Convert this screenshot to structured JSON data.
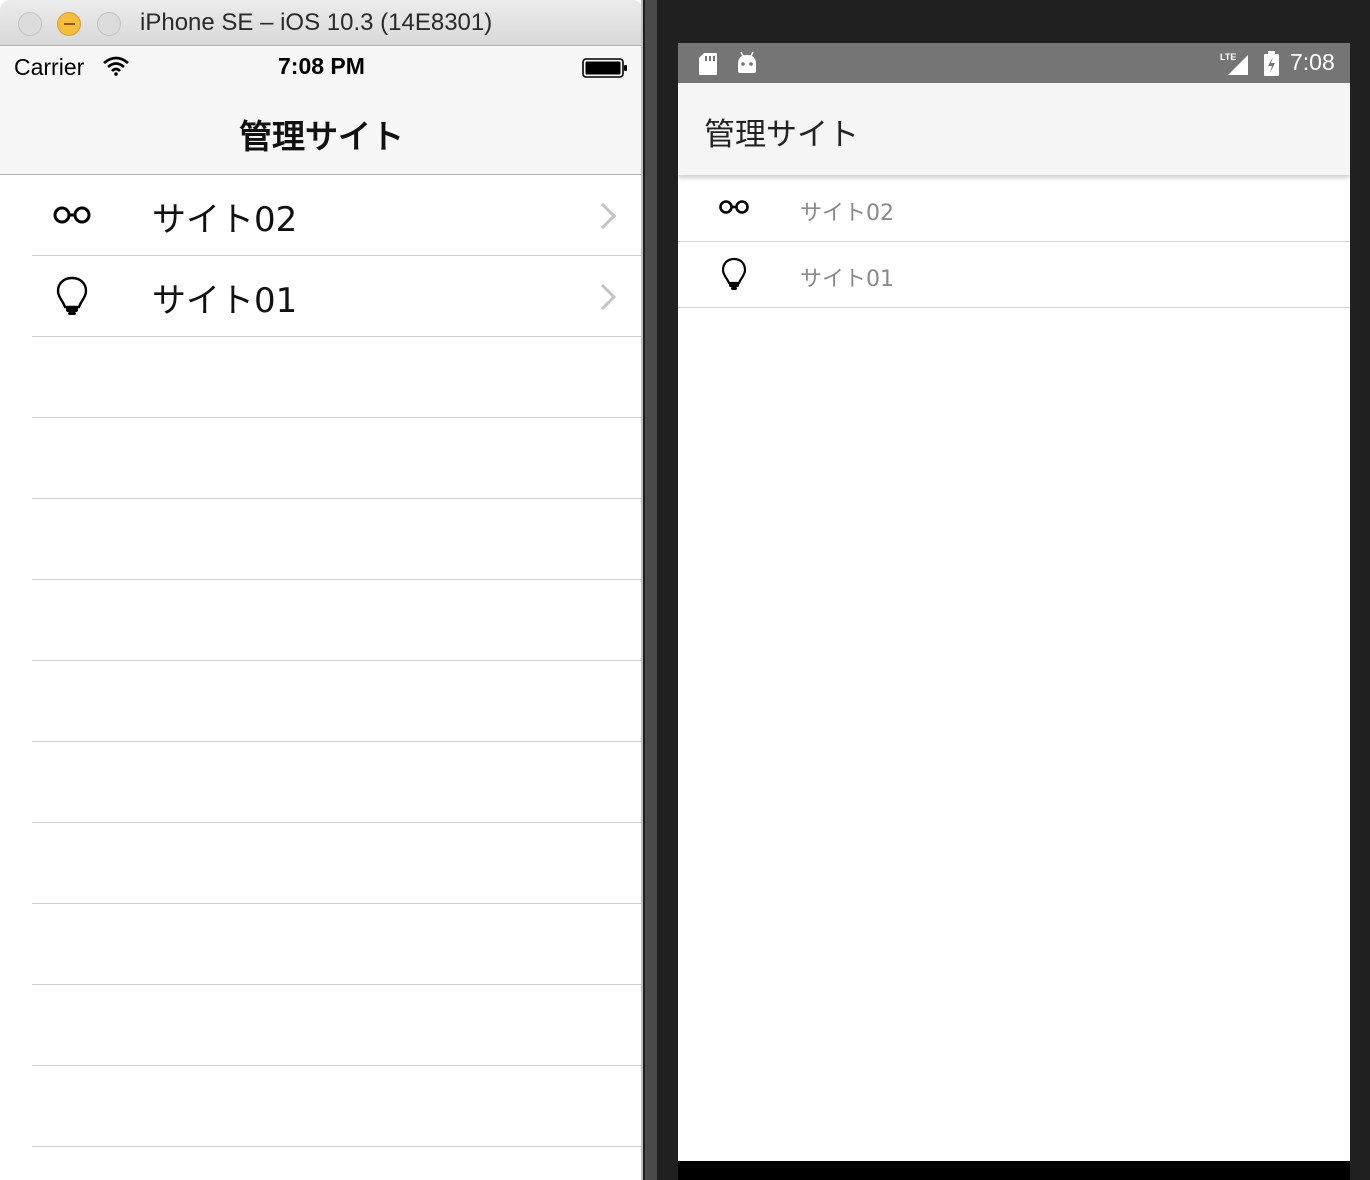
{
  "ios": {
    "window_title": "iPhone SE – iOS 10.3 (14E8301)",
    "status": {
      "carrier": "Carrier",
      "time": "7:08 PM"
    },
    "nav_title": "管理サイト",
    "items": [
      {
        "label": "サイト02",
        "icon": "glasses-icon"
      },
      {
        "label": "サイト01",
        "icon": "lightbulb-icon"
      }
    ]
  },
  "android": {
    "status": {
      "time": "7:08"
    },
    "toolbar_title": "管理サイト",
    "items": [
      {
        "label": "サイト02",
        "icon": "glasses-icon"
      },
      {
        "label": "サイト01",
        "icon": "lightbulb-icon"
      }
    ]
  },
  "colors": {
    "ios_bar": "#f7f7f7",
    "android_status": "#757575",
    "android_toolbar": "#f5f5f5",
    "android_label": "#8a8a8a"
  }
}
